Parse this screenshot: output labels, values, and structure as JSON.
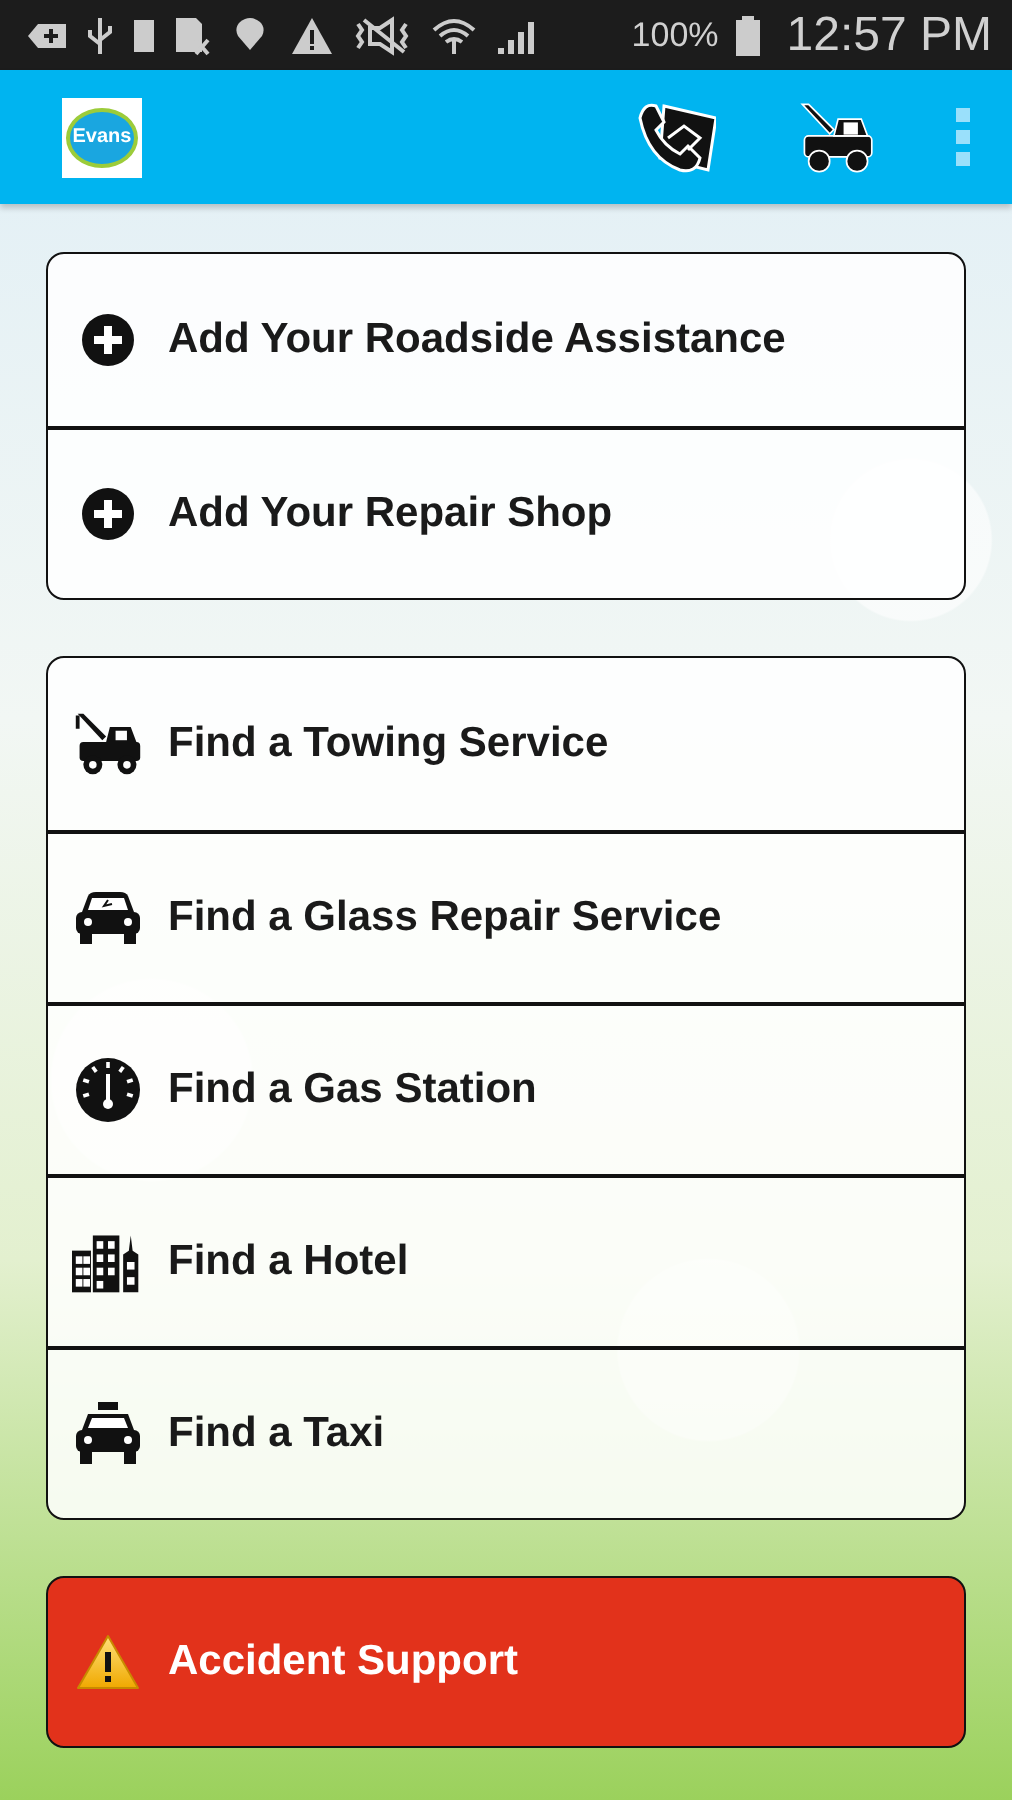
{
  "status_bar": {
    "battery_percent": "100%",
    "time": "12:57 PM"
  },
  "app_bar": {
    "logo_text": "Evans"
  },
  "groups": [
    {
      "items": [
        {
          "kind": "add",
          "label": "Add Your Roadside Assistance"
        },
        {
          "kind": "add",
          "label": "Add Your Repair Shop"
        }
      ]
    },
    {
      "items": [
        {
          "kind": "tow",
          "label": "Find a Towing Service"
        },
        {
          "kind": "glass",
          "label": "Find a Glass Repair Service"
        },
        {
          "kind": "gas",
          "label": "Find a Gas Station"
        },
        {
          "kind": "hotel",
          "label": "Find a Hotel"
        },
        {
          "kind": "taxi",
          "label": "Find a Taxi"
        }
      ]
    }
  ],
  "alert_button": {
    "label": "Accident Support"
  }
}
